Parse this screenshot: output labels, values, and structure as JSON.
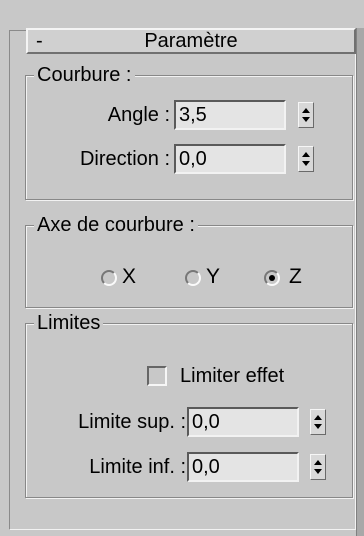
{
  "rollout": {
    "toggle": "-",
    "title": "Paramètre"
  },
  "courbure": {
    "legend": "Courbure :",
    "angle": {
      "label": "Angle :",
      "value": "3,5"
    },
    "direction": {
      "label": "Direction :",
      "value": "0,0"
    }
  },
  "axe": {
    "legend": "Axe de courbure :",
    "options": [
      {
        "label": "X",
        "selected": false
      },
      {
        "label": "Y",
        "selected": false
      },
      {
        "label": "Z",
        "selected": true
      }
    ]
  },
  "limites": {
    "legend": "Limites",
    "limit_effect": {
      "label": "Limiter effet",
      "checked": false
    },
    "upper": {
      "label": "Limite sup. :",
      "value": "0,0"
    },
    "lower": {
      "label": "Limite inf. :",
      "value": "0,0"
    }
  }
}
